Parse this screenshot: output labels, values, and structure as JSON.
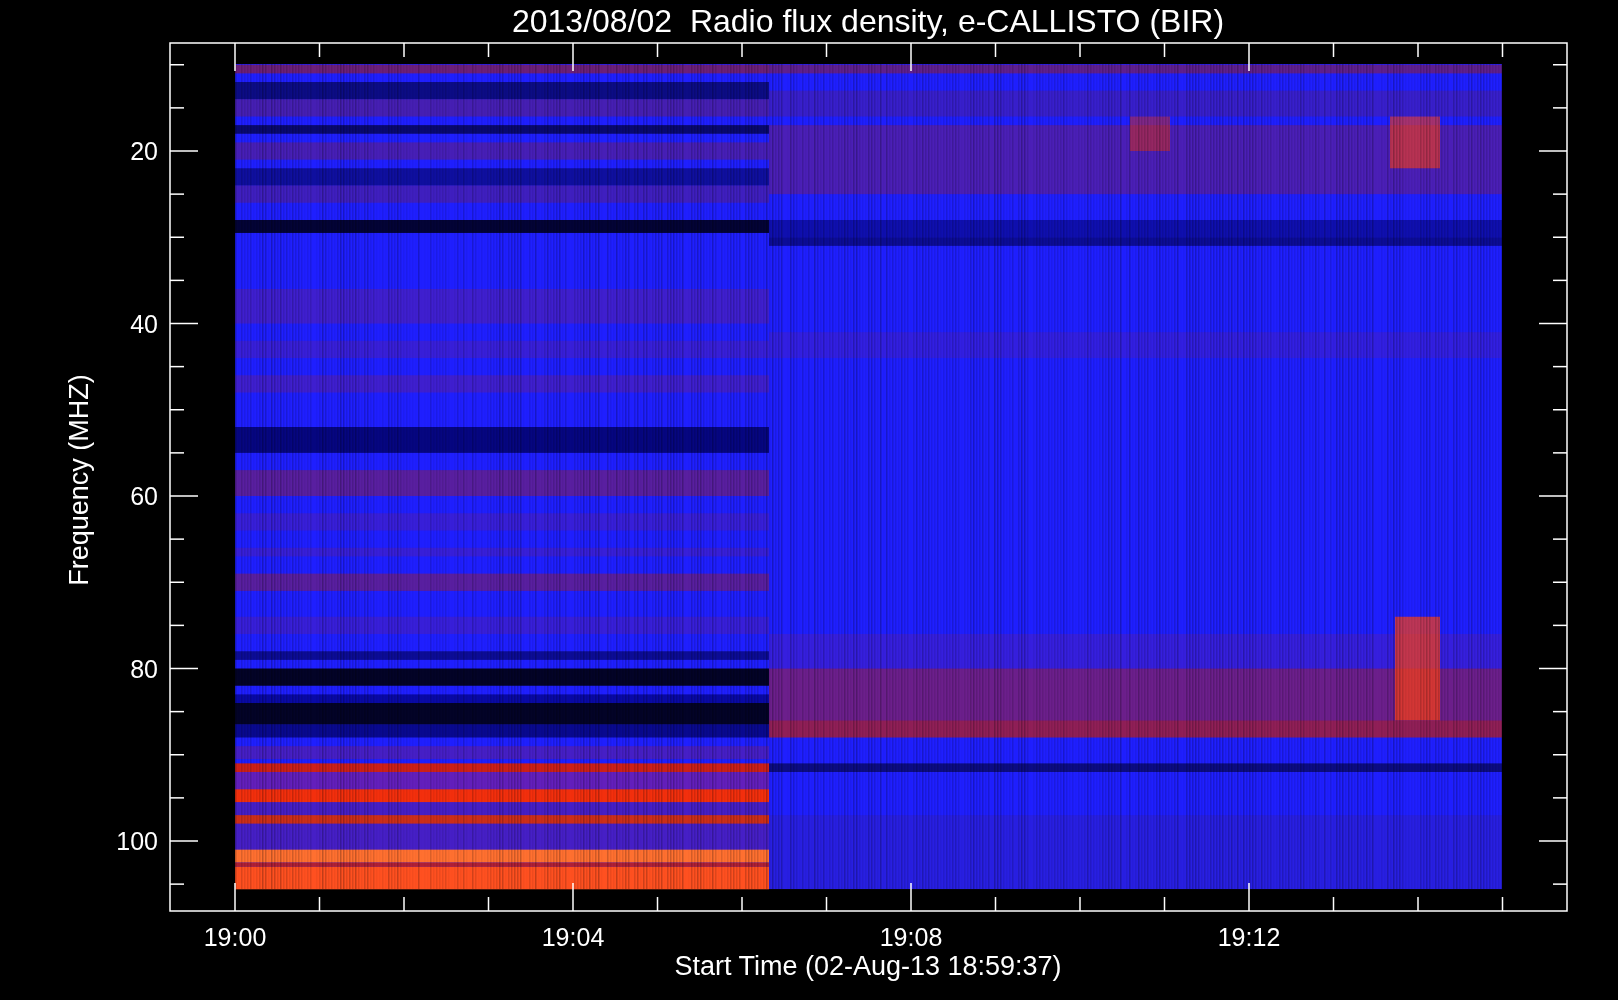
{
  "title": "2013/08/02  Radio flux density, e-CALLISTO (BIR)",
  "y_axis": {
    "label": "Frequency (MHZ)",
    "ticks": [
      "20",
      "40",
      "60",
      "80",
      "100"
    ]
  },
  "x_axis": {
    "label": "Start Time (02-Aug-13 18:59:37)",
    "ticks": [
      "19:00",
      "19:04",
      "19:08",
      "19:12"
    ]
  }
}
